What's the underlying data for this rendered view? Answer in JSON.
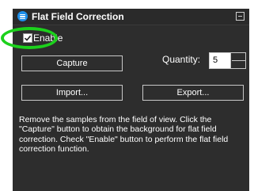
{
  "window": {
    "title": "Flat Field Correction"
  },
  "enable": {
    "label": "Enable",
    "checked": true
  },
  "buttons": {
    "capture": "Capture",
    "import": "Import...",
    "export": "Export..."
  },
  "quantity": {
    "label": "Quantity:",
    "value": "5"
  },
  "description": "Remove the samples from the field of view. Click the \"Capture\" button to obtain the background for flat field correction. Check \"Enable\" button to perform the flat field correction function.",
  "colors": {
    "background": "#2d2d2d",
    "title_icon": "#1e8ee8",
    "highlight": "#1cd11c",
    "text": "#ffffff"
  }
}
